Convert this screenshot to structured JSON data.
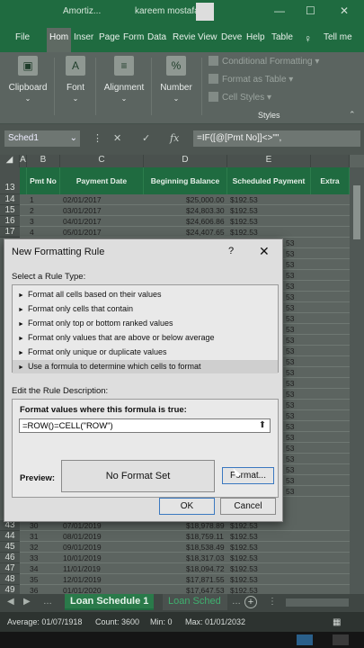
{
  "titlebar": {
    "filename": "Amortiz...",
    "user": "kareem mostafa",
    "min_icon": "minimize-icon",
    "max_icon": "maximize-icon",
    "close_icon": "close-icon"
  },
  "tabs": [
    "File",
    "Hom",
    "Inser",
    "Page",
    "Form",
    "Data",
    "Revie",
    "View",
    "Deve",
    "Help",
    "Table"
  ],
  "tell_me": "Tell me",
  "ribbon": {
    "clipboard": "Clipboard",
    "font": "Font",
    "alignment": "Alignment",
    "number": "Number",
    "number_symbol": "%",
    "font_symbol": "A",
    "conditional_formatting": "Conditional Formatting",
    "format_as_table": "Format as Table",
    "cell_styles": "Cell Styles",
    "styles_group": "Styles"
  },
  "formula_bar": {
    "name_box": "Sched1",
    "formula": "=IF([@[Pmt No]]<>\"\","
  },
  "columns": [
    "A",
    "B",
    "C",
    "D",
    "E"
  ],
  "header_row": {
    "row_number": "13",
    "pmt_no": "Pmt No",
    "payment_date": "Payment Date",
    "beginning_balance": "Beginning Balance",
    "scheduled_payment": "Scheduled Payment",
    "extra": "Extra"
  },
  "top_rows": [
    {
      "row": "14",
      "pmt": "1",
      "date": "02/01/2017",
      "bal": "$25,000.00",
      "pay": "$192.53"
    },
    {
      "row": "15",
      "pmt": "2",
      "date": "03/01/2017",
      "bal": "$24,803.30",
      "pay": "$192.53"
    },
    {
      "row": "16",
      "pmt": "3",
      "date": "04/01/2017",
      "bal": "$24,606.86",
      "pay": "$192.53"
    },
    {
      "row": "17",
      "pmt": "4",
      "date": "05/01/2017",
      "bal": "$24,407.65",
      "pay": "$192.53"
    }
  ],
  "hidden_rows_payment": [
    "53",
    "53",
    "53",
    "53",
    "53",
    "53",
    "53",
    "53",
    "53",
    "53",
    "53",
    "53",
    "53",
    "53",
    "53",
    "53",
    "53",
    "53",
    "53",
    "53",
    "53",
    "53",
    "53",
    "53"
  ],
  "bottom_rows": [
    {
      "row": "43",
      "pmt": "30",
      "date": "07/01/2019",
      "bal": "$18,978.89",
      "pay": "$192.53"
    },
    {
      "row": "44",
      "pmt": "31",
      "date": "08/01/2019",
      "bal": "$18,759.11",
      "pay": "$192.53"
    },
    {
      "row": "45",
      "pmt": "32",
      "date": "09/01/2019",
      "bal": "$18,538.49",
      "pay": "$192.53"
    },
    {
      "row": "46",
      "pmt": "33",
      "date": "10/01/2019",
      "bal": "$18,317.03",
      "pay": "$192.53"
    },
    {
      "row": "47",
      "pmt": "34",
      "date": "11/01/2019",
      "bal": "$18,094.72",
      "pay": "$192.53"
    },
    {
      "row": "48",
      "pmt": "35",
      "date": "12/01/2019",
      "bal": "$17,871.55",
      "pay": "$192.53"
    },
    {
      "row": "49",
      "pmt": "36",
      "date": "01/01/2020",
      "bal": "$17,647.53",
      "pay": "$192.53"
    }
  ],
  "sheets": {
    "active": "Loan Schedule 1",
    "other": "Loan Sched"
  },
  "status": {
    "average": "Average: 01/07/1918",
    "count": "Count: 3600",
    "min": "Min: 0",
    "max": "Max: 01/01/2032"
  },
  "dialog": {
    "title": "New Formatting Rule",
    "help": "?",
    "close": "✕",
    "select_type_label": "Select a Rule Type:",
    "rule_types": [
      "Format all cells based on their values",
      "Format only cells that contain",
      "Format only top or bottom ranked values",
      "Format only values that are above or below average",
      "Format only unique or duplicate values",
      "Use a formula to determine which cells to format"
    ],
    "selected_index": 5,
    "edit_desc_label": "Edit the Rule Description:",
    "formula_label": "Format values where this formula is true:",
    "formula_value": "=ROW()=CELL(\"ROW\")",
    "preview_label": "Preview:",
    "preview_text": "No Format Set",
    "format_button": "Format...",
    "ok_button": "OK",
    "cancel_button": "Cancel"
  }
}
